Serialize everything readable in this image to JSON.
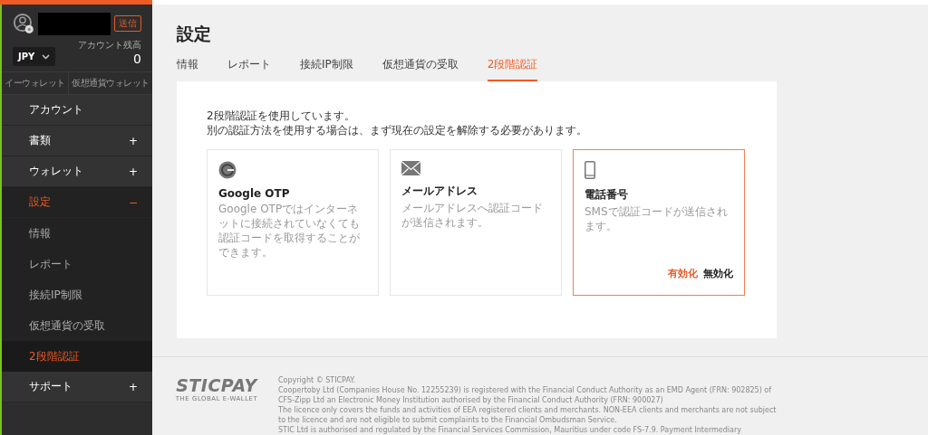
{
  "sidebar": {
    "send_button": "送信",
    "currency": "JPY",
    "balance_label": "アカウント残高",
    "balance": "0",
    "wallet_tabs": [
      {
        "label": "イーウォレット",
        "selected": false
      },
      {
        "label": "仮想通貨ウォレット",
        "selected": false
      }
    ],
    "menu": [
      {
        "label": "アカウント",
        "kind": "link",
        "selected": false
      },
      {
        "label": "書類",
        "kind": "group",
        "expanded": false,
        "toggle": "+"
      },
      {
        "label": "ウォレット",
        "kind": "group",
        "expanded": false,
        "toggle": "+"
      },
      {
        "label": "設定",
        "kind": "group",
        "expanded": true,
        "toggle": "−",
        "children": [
          {
            "label": "情報",
            "selected": false
          },
          {
            "label": "レポート",
            "selected": false
          },
          {
            "label": "接続IP制限",
            "selected": false
          },
          {
            "label": "仮想通貨の受取",
            "selected": false
          },
          {
            "label": "2段階認証",
            "selected": true
          }
        ]
      },
      {
        "label": "サポート",
        "kind": "group",
        "expanded": false,
        "toggle": "+"
      }
    ]
  },
  "page": {
    "title": "設定",
    "tabs": [
      {
        "label": "情報",
        "selected": false
      },
      {
        "label": "レポート",
        "selected": false
      },
      {
        "label": "接続IP制限",
        "selected": false
      },
      {
        "label": "仮想通貨の受取",
        "selected": false
      },
      {
        "label": "2段階認証",
        "selected": true
      }
    ],
    "notice": [
      "2段階認証を使用しています。",
      "別の認証方法を使用する場合は、まず現在の設定を解除する必要があります。"
    ],
    "methods": [
      {
        "kind": "otp",
        "title": "Google OTP",
        "description": "Google OTPではインターネットに接続されていなくても認証コードを取得することができます。",
        "selected": false
      },
      {
        "kind": "email",
        "title": "メールアドレス",
        "description": "メールアドレスへ認証コードが送信されます。",
        "selected": false
      },
      {
        "kind": "phone",
        "title": "電話番号",
        "description": "SMSで認証コードが送信されます。",
        "selected": true,
        "actions": [
          {
            "label": "有効化",
            "selected": true
          },
          {
            "label": "無効化",
            "selected": false
          }
        ]
      }
    ]
  },
  "footer": {
    "logo": "STICPAY",
    "tagline": "THE GLOBAL E-WALLET",
    "lines": [
      "Copyright © STICPAY.",
      "Coopertoby Ltd (Companies House No. 12255239) is registered with the Financial Conduct Authority as an EMD Agent (FRN: 902825) of CFS-Zipp Ltd an Electronic Money Institution authorised by the Financial Conduct Authority (FRN: 900027)",
      "The licence only covers the funds and activities of EEA registered clients and merchants. NON-EEA clients and merchants are not subject to the licence and are not eligible to submit complaints to the Financial Ombudsman Service.",
      "STIC Ltd is authorised and regulated by the Financial Services Commission, Mauritius under code FS-7.9. Payment Intermediary"
    ]
  }
}
